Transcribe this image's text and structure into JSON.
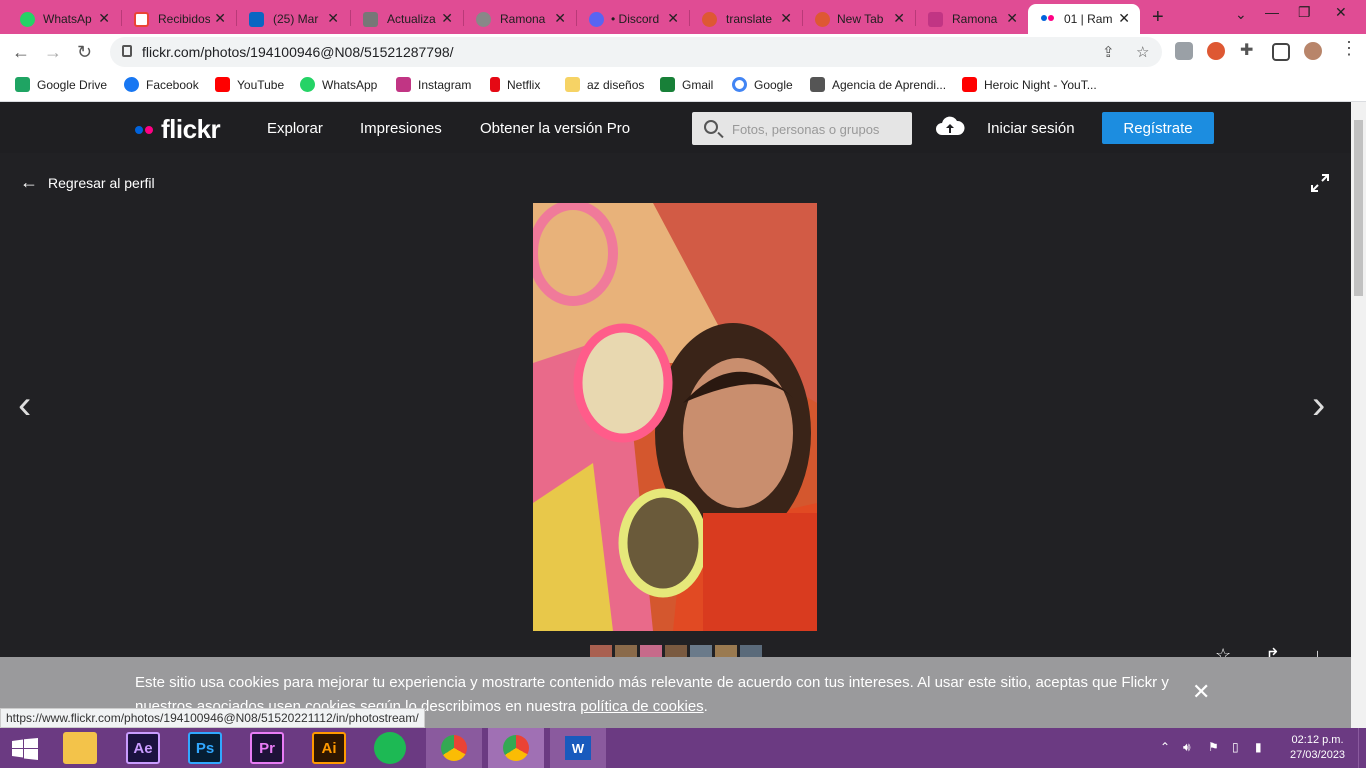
{
  "browser": {
    "tabs": [
      {
        "title": "WhatsAp",
        "favicon": "whatsapp-icon",
        "color": "#25d366"
      },
      {
        "title": "Recibidos",
        "favicon": "gmail-icon",
        "color": "#ea4335"
      },
      {
        "title": "(25) Mar",
        "favicon": "linkedin-icon",
        "color": "#0a66c2"
      },
      {
        "title": "Actualiza",
        "favicon": "page-icon",
        "color": "#777777"
      },
      {
        "title": "Ramona",
        "favicon": "globe-icon",
        "color": "#888888"
      },
      {
        "title": "• Discord",
        "favicon": "discord-icon",
        "color": "#5865f2"
      },
      {
        "title": "translate",
        "favicon": "duckduckgo-icon",
        "color": "#de5833"
      },
      {
        "title": "New Tab",
        "favicon": "duckduckgo-icon",
        "color": "#de5833"
      },
      {
        "title": "Ramona",
        "favicon": "instagram-icon",
        "color": "#c13584"
      },
      {
        "title": "01 | Ram",
        "favicon": "flickr-icon",
        "color": "#0063dc"
      }
    ],
    "url": "flickr.com/photos/194100946@N08/51521287798/",
    "bookmarks": [
      {
        "label": "Google Drive",
        "color": "#1fa463"
      },
      {
        "label": "Facebook",
        "color": "#1877f2"
      },
      {
        "label": "YouTube",
        "color": "#ff0000"
      },
      {
        "label": "WhatsApp",
        "color": "#25d366"
      },
      {
        "label": "Instagram",
        "color": "#c13584"
      },
      {
        "label": "Netflix",
        "color": "#e50914"
      },
      {
        "label": "az diseños",
        "color": "#f6d365"
      },
      {
        "label": "Gmail",
        "color": "#188038"
      },
      {
        "label": "Google",
        "color": "#4285f4"
      },
      {
        "label": "Agencia de Aprendi...",
        "color": "#555555"
      },
      {
        "label": "Heroic Night - YouT...",
        "color": "#ff0000"
      }
    ]
  },
  "flickr": {
    "logo": "flickr",
    "nav": [
      "Explorar",
      "Impresiones",
      "Obtener la versión Pro"
    ],
    "search_placeholder": "Fotos, personas o grupos",
    "signin": "Iniciar sesión",
    "signup": "Regístrate",
    "back_label": "Regresar al perfil"
  },
  "cookie": {
    "text": "Este sitio usa cookies para mejorar tu experiencia y mostrarte contenido más relevante de acuerdo con tus intereses. Al usar este sitio, aceptas que Flickr y nuestros asociados usen cookies según lo describimos en nuestra",
    "link": "política de cookies",
    "end": "."
  },
  "status_url": "https://www.flickr.com/photos/194100946@N08/51520221112/in/photostream/",
  "taskbar": {
    "apps": [
      "Ae",
      "Ps",
      "Pr",
      "Ai"
    ],
    "time": "02:12 p.m.",
    "date": "27/03/2023"
  },
  "colors": {
    "accent": "#1c8de0",
    "tabbar": "#e04c94",
    "taskbar": "#6b3a82"
  }
}
